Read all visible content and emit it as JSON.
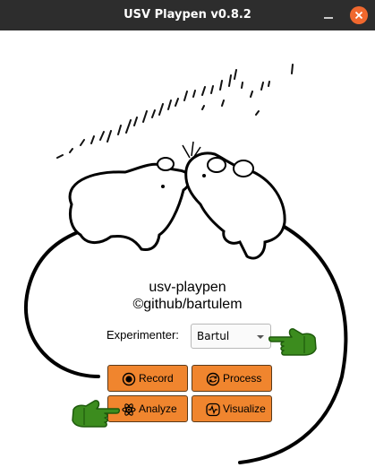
{
  "window": {
    "title": "USV Playpen v0.8.2"
  },
  "app": {
    "name": "usv-playpen",
    "credit": "©github/bartulem"
  },
  "experimenter": {
    "label": "Experimenter:",
    "selected": "Bartul"
  },
  "buttons": {
    "record": "Record",
    "process": "Process",
    "analyze": "Analyze",
    "visualize": "Visualize"
  },
  "colors": {
    "titlebar": "#2d2d2d",
    "button": "#f0852e",
    "close": "#f0682e",
    "pointer": "#3c8c1e"
  }
}
